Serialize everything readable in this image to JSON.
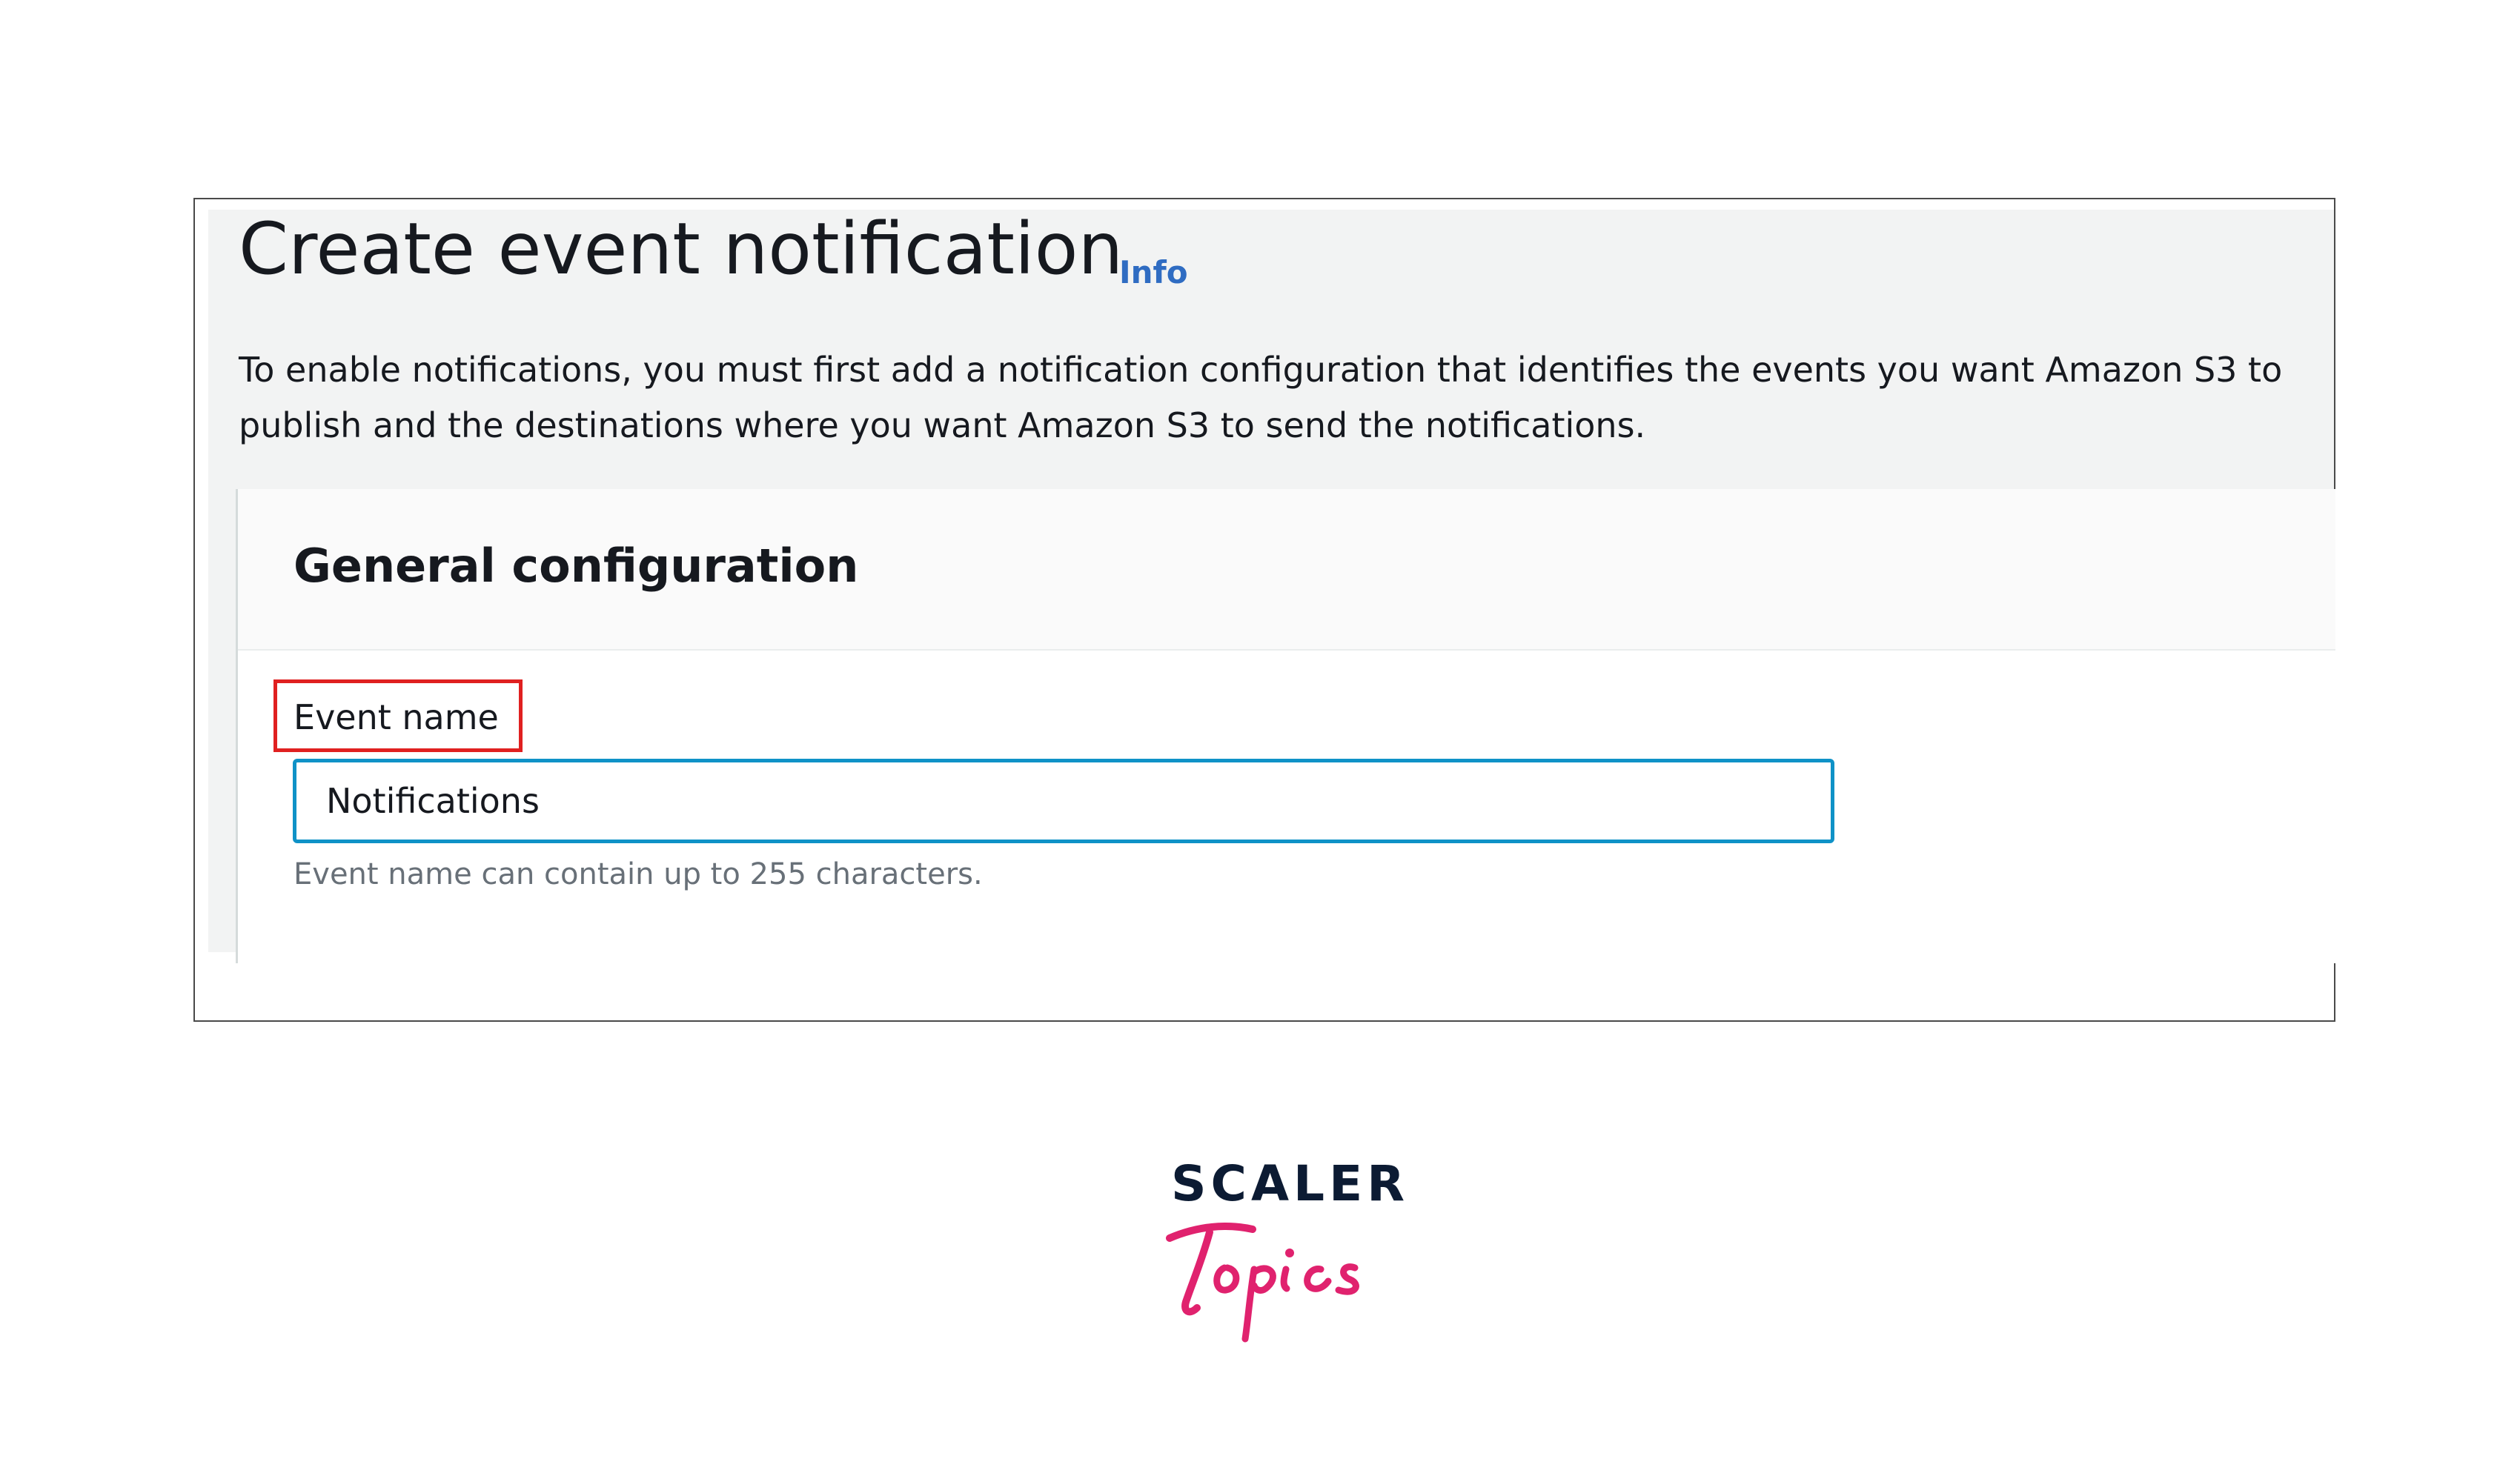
{
  "page": {
    "title": "Create event notification",
    "info_link": "Info",
    "description": "To enable notifications, you must first add a notification configuration that identifies the events you want Amazon S3 to publish and the destinations where you want Amazon S3 to send the notifications."
  },
  "general_configuration": {
    "title": "General configuration",
    "event_name": {
      "label": "Event name",
      "value": "Notifications",
      "helper": "Event name can contain up to 255 characters."
    }
  },
  "brand": {
    "wordmark": "SCALER",
    "script": "Topics"
  },
  "colors": {
    "info_link": "#2f6cc2",
    "input_focus_border": "#0f92c7",
    "highlight_box": "#e02020",
    "brand_navy": "#0c1b33",
    "brand_pink": "#e0226e"
  }
}
